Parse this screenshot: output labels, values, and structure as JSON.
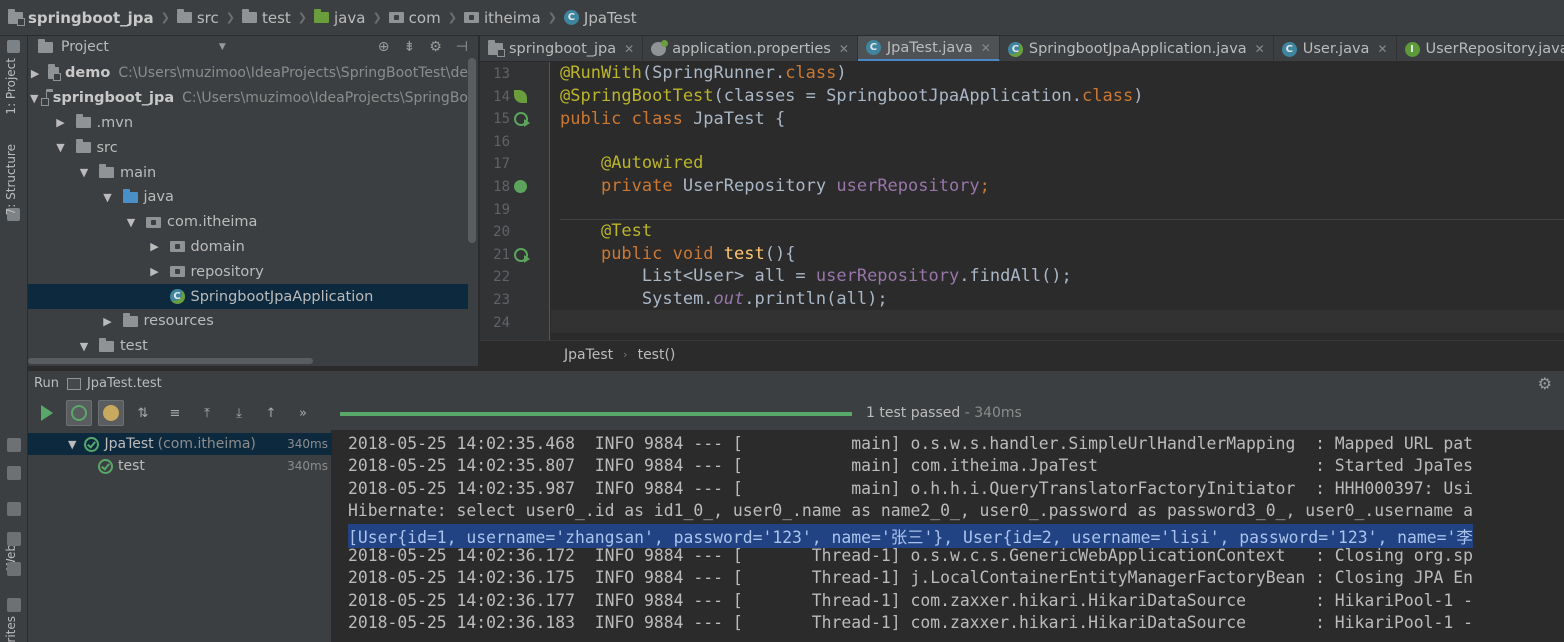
{
  "breadcrumb": [
    {
      "label": "springboot_jpa",
      "icon": "module-folder-icon",
      "bold": true
    },
    {
      "label": "src",
      "icon": "folder-icon"
    },
    {
      "label": "test",
      "icon": "folder-icon"
    },
    {
      "label": "java",
      "icon": "test-source-folder-icon"
    },
    {
      "label": "com",
      "icon": "package-icon"
    },
    {
      "label": "itheima",
      "icon": "package-icon"
    },
    {
      "label": "JpaTest",
      "icon": "class-icon"
    }
  ],
  "left_strip": {
    "project_tab": "1: Project",
    "structure_tab": "7: Structure",
    "web_tab": "Web",
    "favorites_tab": "rites"
  },
  "project": {
    "title": "Project",
    "tree": [
      {
        "label": "demo",
        "path": "C:\\Users\\muzimoo\\IdeaProjects\\SpringBootTest\\de",
        "arrow": "▶",
        "icon": "module",
        "depth": 0,
        "bold": true
      },
      {
        "label": "springboot_jpa",
        "path": "C:\\Users\\muzimoo\\IdeaProjects\\SpringBo",
        "arrow": "▼",
        "icon": "module",
        "depth": 0,
        "bold": true
      },
      {
        "label": ".mvn",
        "arrow": "▶",
        "icon": "folder",
        "depth": 1
      },
      {
        "label": "src",
        "arrow": "▼",
        "icon": "folder",
        "depth": 1
      },
      {
        "label": "main",
        "arrow": "▼",
        "icon": "folder",
        "depth": 2
      },
      {
        "label": "java",
        "arrow": "▼",
        "icon": "folder-blue",
        "depth": 3
      },
      {
        "label": "com.itheima",
        "arrow": "▼",
        "icon": "package",
        "depth": 4
      },
      {
        "label": "domain",
        "arrow": "▶",
        "icon": "package",
        "depth": 5
      },
      {
        "label": "repository",
        "arrow": "▶",
        "icon": "package",
        "depth": 5
      },
      {
        "label": "SpringbootJpaApplication",
        "arrow": "",
        "icon": "spring-class",
        "depth": 5,
        "selected": true
      },
      {
        "label": "resources",
        "arrow": "▶",
        "icon": "folder",
        "depth": 3
      },
      {
        "label": "test",
        "arrow": "▼",
        "icon": "folder",
        "depth": 2
      }
    ]
  },
  "editor": {
    "tabs": [
      {
        "label": "springboot_jpa",
        "icon": "module-folder-icon"
      },
      {
        "label": "application.properties",
        "icon": "properties-file-icon"
      },
      {
        "label": "JpaTest.java",
        "icon": "class-icon",
        "active": true
      },
      {
        "label": "SpringbootJpaApplication.java",
        "icon": "spring-class-icon"
      },
      {
        "label": "User.java",
        "icon": "class-icon"
      },
      {
        "label": "UserRepository.java",
        "icon": "interface-icon"
      }
    ],
    "line_numbers": [
      "13",
      "14",
      "15",
      "16",
      "17",
      "18",
      "19",
      "20",
      "21",
      "22",
      "23",
      "24"
    ],
    "code": {
      "l13_ann": "@RunWith",
      "l13_rest": "(SpringRunner.",
      "l13_kw": "class",
      "l13_end": ")",
      "l14_ann": "@SpringBootTest",
      "l14_rest": "(classes = SpringbootJpaApplication.",
      "l14_kw": "class",
      "l14_end": ")",
      "l15_kw": "public class",
      "l15_rest": " JpaTest {",
      "l17_ann": "@Autowired",
      "l18_kw": "private",
      "l18_type": " UserRepository ",
      "l18_fld": "userRepository",
      "l18_end": ";",
      "l20_ann": "@Test",
      "l21_kw": "public void",
      "l21_fn": " test",
      "l21_end": "(){",
      "l22_type": "List<User> all = ",
      "l22_fld": "userRepository",
      "l22_end": ".findAll();",
      "l23_a": "System.",
      "l23_out": "out",
      "l23_end": ".println(all);"
    },
    "breadcrumb": [
      "JpaTest",
      "test()"
    ]
  },
  "run": {
    "title": "Run",
    "config": "JpaTest.test",
    "status": "1 test passed",
    "duration": " - 340ms",
    "progress": 1.0,
    "toolbar_more": "»",
    "tests": [
      {
        "name": "JpaTest",
        "package": "(com.itheima)",
        "time": "340ms",
        "arrow": "▼",
        "selected": true
      },
      {
        "name": "test",
        "package": "",
        "time": "340ms",
        "arrow": ""
      }
    ],
    "console": [
      "2018-05-25 14:02:35.468  INFO 9884 --- [           main] o.s.w.s.handler.SimpleUrlHandlerMapping  : Mapped URL pat",
      "2018-05-25 14:02:35.807  INFO 9884 --- [           main] com.itheima.JpaTest                      : Started JpaTes",
      "2018-05-25 14:02:35.987  INFO 9884 --- [           main] o.h.h.i.QueryTranslatorFactoryInitiator  : HHH000397: Usi",
      "Hibernate: select user0_.id as id1_0_, user0_.name as name2_0_, user0_.password as password3_0_, user0_.username a",
      "[User{id=1, username='zhangsan', password='123', name='张三'}, User{id=2, username='lisi', password='123', name='李",
      "2018-05-25 14:02:36.172  INFO 9884 --- [       Thread-1] o.s.w.c.s.GenericWebApplicationContext   : Closing org.sp",
      "2018-05-25 14:02:36.175  INFO 9884 --- [       Thread-1] j.LocalContainerEntityManagerFactoryBean : Closing JPA En",
      "2018-05-25 14:02:36.177  INFO 9884 --- [       Thread-1] com.zaxxer.hikari.HikariDataSource       : HikariPool-1 -",
      "2018-05-25 14:02:36.183  INFO 9884 --- [       Thread-1] com.zaxxer.hikari.HikariDataSource       : HikariPool-1 -"
    ],
    "highlighted_line": 4
  }
}
